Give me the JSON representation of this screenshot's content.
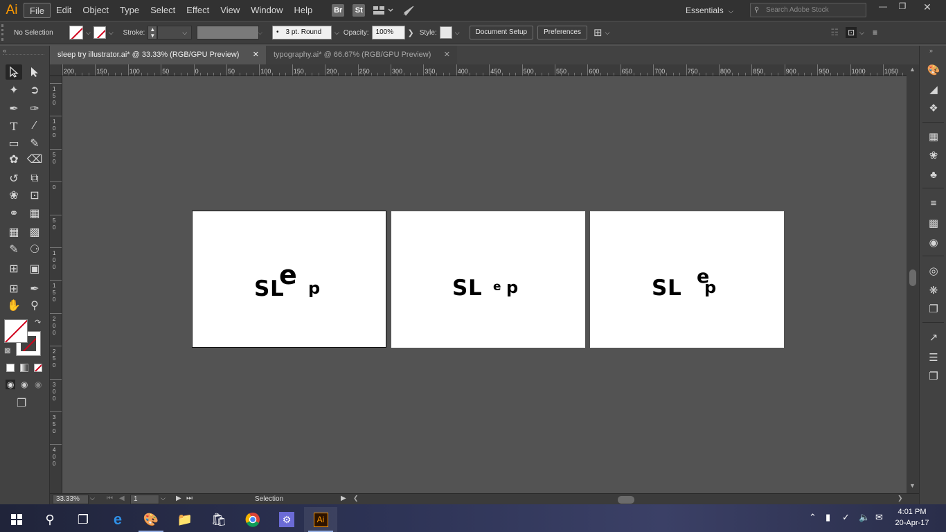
{
  "app": {
    "logo": "Ai",
    "menu": [
      "File",
      "Edit",
      "Object",
      "Type",
      "Select",
      "Effect",
      "View",
      "Window",
      "Help"
    ],
    "bridge_label": "Br",
    "stock_label": "St",
    "workspace": "Essentials",
    "search_placeholder": "Search Adobe Stock"
  },
  "control_bar": {
    "selection_status": "No Selection",
    "stroke_label": "Stroke:",
    "brush": "3 pt. Round",
    "opacity_label": "Opacity:",
    "opacity_value": "100%",
    "style_label": "Style:",
    "document_setup": "Document Setup",
    "preferences": "Preferences"
  },
  "tabs": [
    {
      "label": "sleep try illustrator.ai* @ 33.33% (RGB/GPU Preview)",
      "active": true
    },
    {
      "label": "typography.ai* @ 66.67% (RGB/GPU Preview)",
      "active": false
    }
  ],
  "ruler_top": [
    "200",
    "150",
    "100",
    "50",
    "0",
    "50",
    "100",
    "150",
    "200",
    "250",
    "300",
    "350",
    "400",
    "450",
    "500",
    "550",
    "600",
    "650",
    "700",
    "750",
    "800",
    "850",
    "900",
    "950",
    "1000",
    "1050"
  ],
  "ruler_left": [
    "1 5 0",
    "1 0 0",
    "5 0",
    "0",
    "5 0",
    "1 0 0",
    "1 5 0",
    "2 0 0",
    "2 5 0",
    "3 0 0",
    "3 5 0",
    "4 0 0"
  ],
  "artboards": [
    {
      "s": "S",
      "l": "L",
      "e": "e",
      "p": "p"
    },
    {
      "s": "S",
      "l": "L",
      "e": "e",
      "p": "p"
    },
    {
      "s": "S",
      "l": "L",
      "e": "e",
      "p": "p"
    }
  ],
  "status_bar": {
    "zoom": "33.33%",
    "artboard_number": "1",
    "tool": "Selection"
  },
  "taskbar": {
    "time": "4:01 PM",
    "date": "20-Apr-17",
    "ai_label": "Ai"
  },
  "colors": {
    "accent_ai": "#ff9a00",
    "none_swatch_line": "#d0021b"
  }
}
